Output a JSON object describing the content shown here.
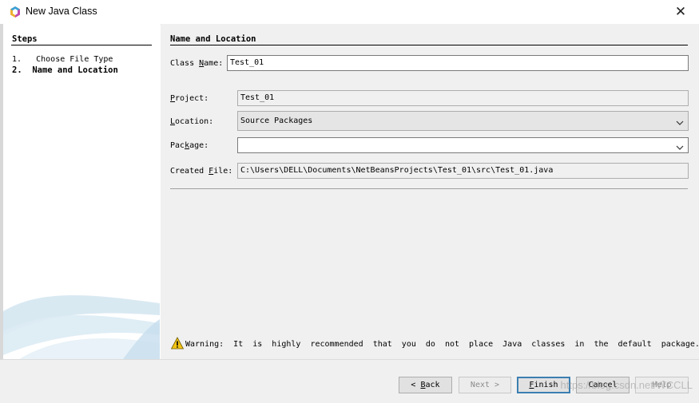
{
  "window": {
    "title": "New Java Class"
  },
  "steps": {
    "title": "Steps",
    "items": [
      {
        "num": "1.",
        "label": "Choose File Type"
      },
      {
        "num": "2.",
        "label": "Name and Location"
      }
    ]
  },
  "form": {
    "section_title": "Name and Location",
    "class_name": {
      "label_pre": "Class ",
      "label_u": "N",
      "label_post": "ame:",
      "value": "Test_01"
    },
    "project": {
      "label_u": "P",
      "label_post": "roject:",
      "value": "Test_01"
    },
    "location": {
      "label_u": "L",
      "label_post": "ocation:",
      "value": "Source Packages"
    },
    "package": {
      "label_pre": "Pac",
      "label_u": "k",
      "label_post": "age:",
      "value": ""
    },
    "created_file": {
      "label_pre": "Created ",
      "label_u": "F",
      "label_post": "ile:",
      "value": "C:\\Users\\DELL\\Documents\\NetBeansProjects\\Test_01\\src\\Test_01.java"
    }
  },
  "warning": {
    "text": "Warning: It is highly recommended that you do not place Java classes in the default package."
  },
  "buttons": {
    "back": {
      "arrow": "<",
      "u": "B",
      "rest": "ack"
    },
    "next": {
      "label": "Next",
      "arrow": ">"
    },
    "finish": {
      "u": "F",
      "rest": "inish"
    },
    "cancel": {
      "label": "Cancel"
    },
    "help": {
      "label": "Help"
    }
  },
  "watermark": "https://blog.csdn.net/WCCLL"
}
